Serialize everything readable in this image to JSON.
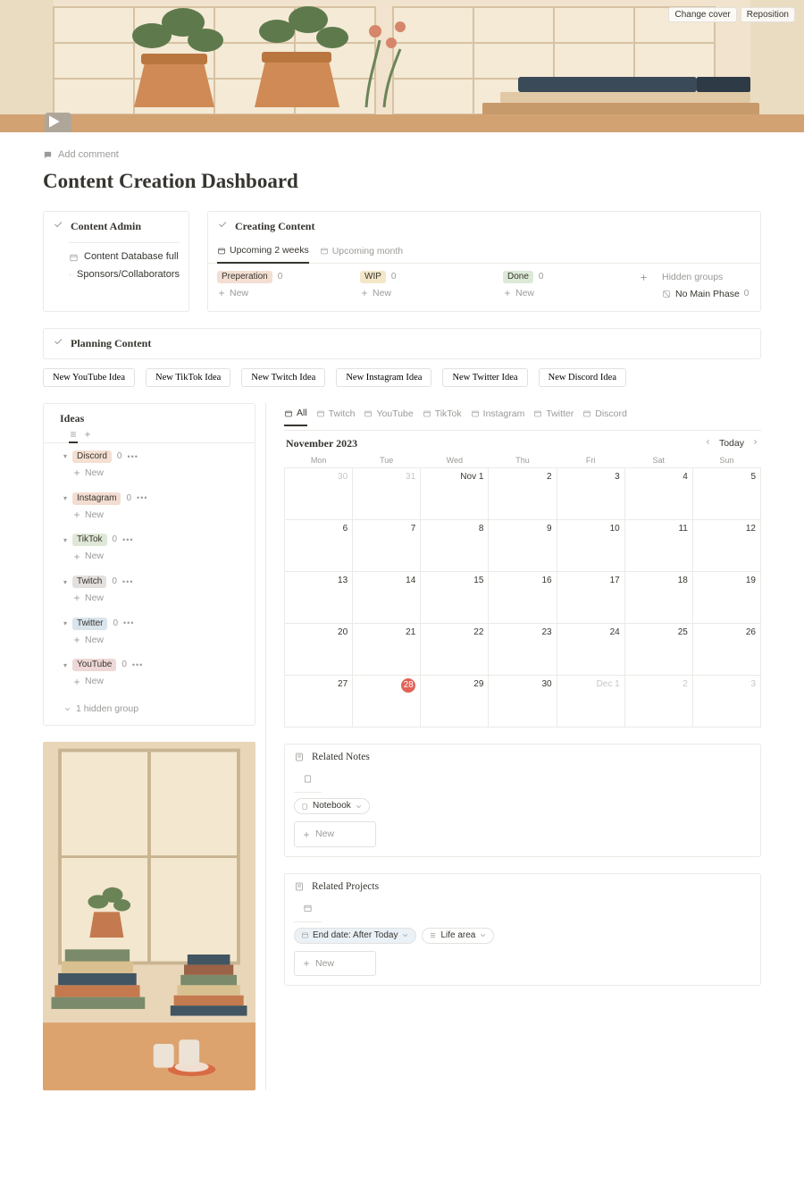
{
  "cover": {
    "change": "Change cover",
    "reposition": "Reposition"
  },
  "add_comment": "Add comment",
  "title": "Content Creation Dashboard",
  "admin": {
    "heading": "Content Admin",
    "links": [
      {
        "label": "Content Database full"
      },
      {
        "label": "Sponsors/Collaborators"
      }
    ]
  },
  "creating": {
    "heading": "Creating Content",
    "tabs": [
      {
        "label": "Upcoming 2 weeks",
        "active": true
      },
      {
        "label": "Upcoming month",
        "active": false
      }
    ],
    "cols": [
      {
        "tag": "Preperation",
        "tag_class": "tag-prep",
        "count": 0
      },
      {
        "tag": "WIP",
        "tag_class": "tag-wip",
        "count": 0
      },
      {
        "tag": "Done",
        "tag_class": "tag-done",
        "count": 0
      }
    ],
    "new_label": "New",
    "hidden_label": "Hidden groups",
    "no_main_phase": "No Main Phase",
    "no_main_count": 0
  },
  "planning": {
    "heading": "Planning Content"
  },
  "idea_buttons": [
    "New YouTube Idea",
    "New TikTok Idea",
    "New Twitch Idea",
    "New Instagram Idea",
    "New Twitter Idea",
    "New Discord Idea"
  ],
  "ideas": {
    "heading": "Ideas",
    "new": "New",
    "hidden": "1 hidden group",
    "groups": [
      {
        "name": "Discord",
        "class": "tag-discord",
        "count": 0
      },
      {
        "name": "Instagram",
        "class": "tag-instagram",
        "count": 0
      },
      {
        "name": "TikTok",
        "class": "tag-tiktok",
        "count": 0
      },
      {
        "name": "Twitch",
        "class": "tag-twitch",
        "count": 0
      },
      {
        "name": "Twitter",
        "class": "tag-twitter",
        "count": 0
      },
      {
        "name": "YouTube",
        "class": "tag-youtube",
        "count": 0
      }
    ]
  },
  "cal_tabs": [
    "All",
    "Twitch",
    "YouTube",
    "TikTok",
    "Instagram",
    "Twitter",
    "Discord"
  ],
  "calendar": {
    "month": "November 2023",
    "today_label": "Today",
    "dow": [
      "Mon",
      "Tue",
      "Wed",
      "Thu",
      "Fri",
      "Sat",
      "Sun"
    ],
    "weeks": [
      [
        {
          "d": "30",
          "out": true
        },
        {
          "d": "31",
          "out": true
        },
        {
          "d": "Nov 1"
        },
        {
          "d": "2"
        },
        {
          "d": "3"
        },
        {
          "d": "4"
        },
        {
          "d": "5"
        }
      ],
      [
        {
          "d": "6"
        },
        {
          "d": "7"
        },
        {
          "d": "8"
        },
        {
          "d": "9"
        },
        {
          "d": "10"
        },
        {
          "d": "11"
        },
        {
          "d": "12"
        }
      ],
      [
        {
          "d": "13"
        },
        {
          "d": "14"
        },
        {
          "d": "15"
        },
        {
          "d": "16"
        },
        {
          "d": "17"
        },
        {
          "d": "18"
        },
        {
          "d": "19"
        }
      ],
      [
        {
          "d": "20"
        },
        {
          "d": "21"
        },
        {
          "d": "22"
        },
        {
          "d": "23"
        },
        {
          "d": "24"
        },
        {
          "d": "25"
        },
        {
          "d": "26"
        }
      ],
      [
        {
          "d": "27"
        },
        {
          "d": "28",
          "today": true
        },
        {
          "d": "29"
        },
        {
          "d": "30"
        },
        {
          "d": "Dec 1",
          "out": true
        },
        {
          "d": "2",
          "out": true
        },
        {
          "d": "3",
          "out": true
        }
      ]
    ]
  },
  "related_notes": {
    "heading": "Related Notes",
    "chip": "Notebook",
    "new": "New"
  },
  "related_projects": {
    "heading": "Related Projects",
    "chip_date": "End date: After Today",
    "chip_life": "Life area",
    "new": "New"
  }
}
